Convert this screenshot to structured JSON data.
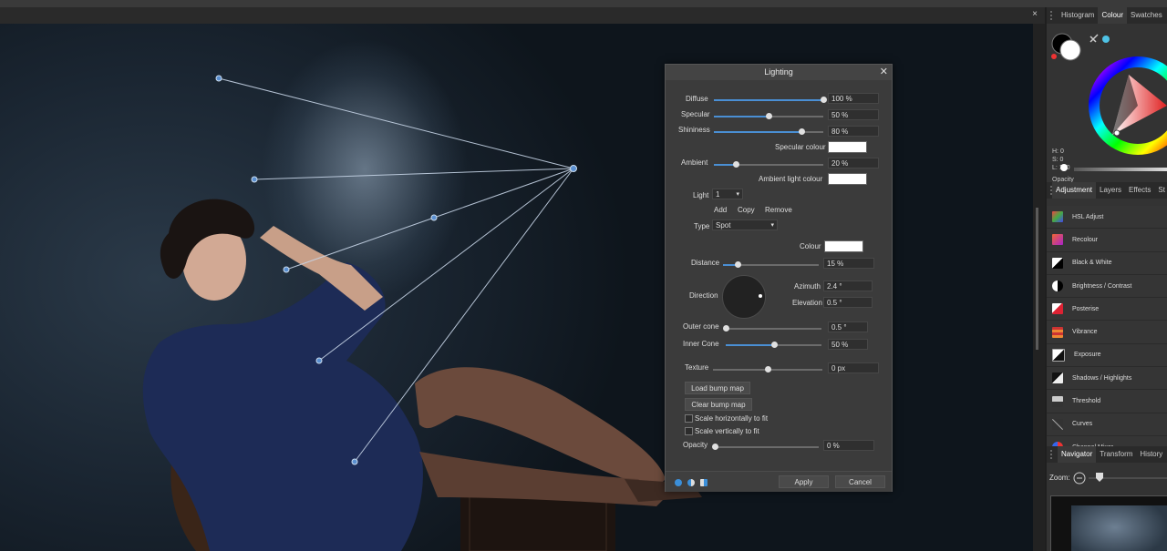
{
  "window": {
    "close_glyph": "×"
  },
  "studio": {
    "top_tabs": [
      "Histogram",
      "Colour",
      "Swatches"
    ],
    "colour": {
      "h": "H: 0",
      "s": "S: 0",
      "l": "L: 100",
      "opacity_label": "Opacity"
    },
    "mid_tabs": [
      "Adjustment",
      "Layers",
      "Effects",
      "St"
    ],
    "adjustments": [
      {
        "label": "HSL Adjust",
        "icon": "hsl-adjust-icon",
        "color": "#c9463d"
      },
      {
        "label": "Recolour",
        "icon": "recolour-icon",
        "color": "#b23b5e"
      },
      {
        "label": "Black & White",
        "icon": "black-white-icon",
        "color": "#e6e6e6"
      },
      {
        "label": "Brightness / Contrast",
        "icon": "brightness-contrast-icon",
        "color": "#e6e6e6"
      },
      {
        "label": "Posterise",
        "icon": "posterise-icon",
        "color": "#c8374a"
      },
      {
        "label": "Vibrance",
        "icon": "vibrance-icon",
        "color": "#e1862b"
      },
      {
        "label": "Exposure",
        "icon": "exposure-icon",
        "color": "#dddddd"
      },
      {
        "label": "Shadows / Highlights",
        "icon": "shadows-highlights-icon",
        "color": "#dddddd"
      },
      {
        "label": "Threshold",
        "icon": "threshold-icon",
        "color": "#999999"
      },
      {
        "label": "Curves",
        "icon": "curves-icon",
        "color": "#aaaaaa"
      },
      {
        "label": "Channel Mixer",
        "icon": "channel-mixer-icon",
        "color": "#3fb37a"
      }
    ],
    "bottom_tabs": [
      "Navigator",
      "Transform",
      "History"
    ],
    "zoom_label": "Zoom:"
  },
  "lighting": {
    "title": "Lighting",
    "close": "✕",
    "diffuse": {
      "label": "Diffuse",
      "value": "100 %",
      "level": 1.0
    },
    "specular": {
      "label": "Specular",
      "value": "50 %",
      "level": 0.5
    },
    "shininess": {
      "label": "Shininess",
      "value": "80 %",
      "level": 0.8
    },
    "specular_colour_label": "Specular colour",
    "ambient": {
      "label": "Ambient",
      "value": "20 %",
      "level": 0.2
    },
    "ambient_colour_label": "Ambient light colour",
    "light_label": "Light",
    "light_value": "1",
    "add": "Add",
    "copy": "Copy",
    "remove": "Remove",
    "type_label": "Type",
    "type_value": "Spot",
    "colour_label": "Colour",
    "distance": {
      "label": "Distance",
      "value": "15 %",
      "level": 0.15
    },
    "direction_label": "Direction",
    "azimuth_label": "Azimuth",
    "azimuth_value": "2.4 °",
    "elevation_label": "Elevation",
    "elevation_value": "0.5 °",
    "outer_cone": {
      "label": "Outer cone",
      "value": "0.5 °",
      "level": 0.0
    },
    "inner_cone": {
      "label": "Inner Cone",
      "value": "50 %",
      "level": 0.5
    },
    "texture": {
      "label": "Texture",
      "value": "0 px",
      "level": 0.5
    },
    "load_bump": "Load bump map",
    "clear_bump": "Clear bump map",
    "scale_h": "Scale horizontally to fit",
    "scale_v": "Scale vertically to fit",
    "opacity": {
      "label": "Opacity",
      "value": "0 %",
      "level": 0.0
    },
    "apply": "Apply",
    "cancel": "Cancel"
  }
}
